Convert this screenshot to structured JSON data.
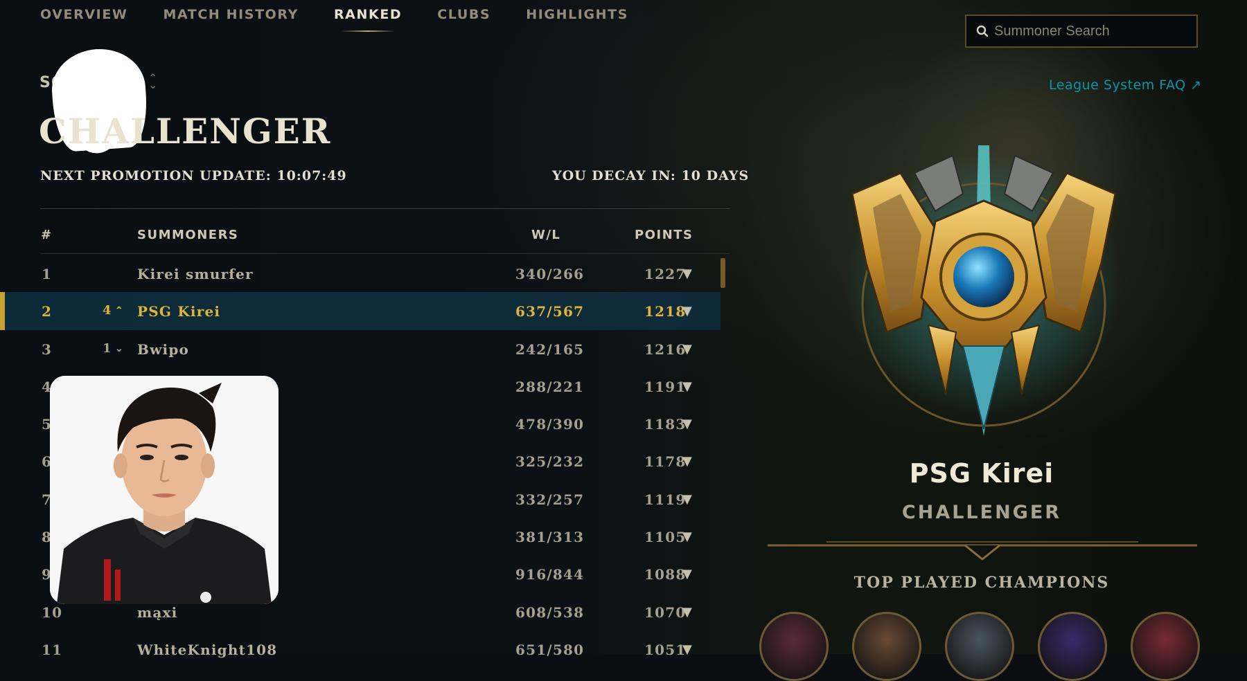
{
  "nav": {
    "tabs": [
      {
        "label": "OVERVIEW"
      },
      {
        "label": "MATCH HISTORY"
      },
      {
        "label": "RANKED"
      },
      {
        "label": "CLUBS"
      },
      {
        "label": "HIGHLIGHTS"
      }
    ],
    "active_tab": "RANKED"
  },
  "search": {
    "placeholder": "Summoner Search",
    "icon": "search-icon"
  },
  "faq_link": {
    "label": "League System FAQ ↗"
  },
  "queue": {
    "label_visible": "SO",
    "icon": "chevron-updown-icon"
  },
  "tier_title": "CHALLENGER",
  "promotion": {
    "label": "NEXT PROMOTION UPDATE: 10:07:49"
  },
  "decay": {
    "label": "YOU DECAY IN: 10 DAYS"
  },
  "table": {
    "headers": {
      "rank": "#",
      "summoners": "SUMMONERS",
      "wl": "W/L",
      "points": "POINTS"
    },
    "rows": [
      {
        "rank": "1",
        "delta": "",
        "delta_dir": "",
        "name": "Kirei smurfer",
        "wl": "340/266",
        "points": "1227"
      },
      {
        "rank": "2",
        "delta": "4",
        "delta_dir": "up",
        "name": "PSG Kirei",
        "wl": "637/567",
        "points": "1218",
        "highlight": true
      },
      {
        "rank": "3",
        "delta": "1",
        "delta_dir": "down",
        "name": "Bwipo",
        "wl": "242/165",
        "points": "1216"
      },
      {
        "rank": "4",
        "delta": "",
        "delta_dir": "",
        "name": "",
        "wl": "288/221",
        "points": "1191"
      },
      {
        "rank": "5",
        "delta": "",
        "delta_dir": "",
        "name": "",
        "wl": "478/390",
        "points": "1183"
      },
      {
        "rank": "6",
        "delta": "",
        "delta_dir": "",
        "name": "",
        "wl": "325/232",
        "points": "1178"
      },
      {
        "rank": "7",
        "delta": "",
        "delta_dir": "",
        "name": "",
        "wl": "332/257",
        "points": "1119"
      },
      {
        "rank": "8",
        "delta": "",
        "delta_dir": "",
        "name": "",
        "wl": "381/313",
        "points": "1105"
      },
      {
        "rank": "9",
        "delta": "",
        "delta_dir": "",
        "name": "",
        "wl": "916/844",
        "points": "1088"
      },
      {
        "rank": "10",
        "delta": "",
        "delta_dir": "",
        "name": "mąxi",
        "wl": "608/538",
        "points": "1070"
      },
      {
        "rank": "11",
        "delta": "",
        "delta_dir": "",
        "name": "WhiteKnight108",
        "wl": "651/580",
        "points": "1051"
      }
    ]
  },
  "profile": {
    "name": "PSG Kirei",
    "tier": "CHALLENGER",
    "top_played_label": "TOP PLAYED CHAMPIONS",
    "champions": [
      {
        "icon": "champion-1-icon",
        "color": "#5a2a3a"
      },
      {
        "icon": "champion-2-icon",
        "color": "#6a4a35"
      },
      {
        "icon": "champion-3-icon",
        "color": "#4a5560"
      },
      {
        "icon": "champion-4-icon",
        "color": "#3a2a6a"
      },
      {
        "icon": "champion-5-icon",
        "color": "#7a2a35"
      }
    ]
  },
  "colors": {
    "accent_gold": "#c8aa6e",
    "highlight_gold": "#e0b43a",
    "link_teal": "#0a96aa",
    "highlight_row": "#0f2c3a"
  }
}
